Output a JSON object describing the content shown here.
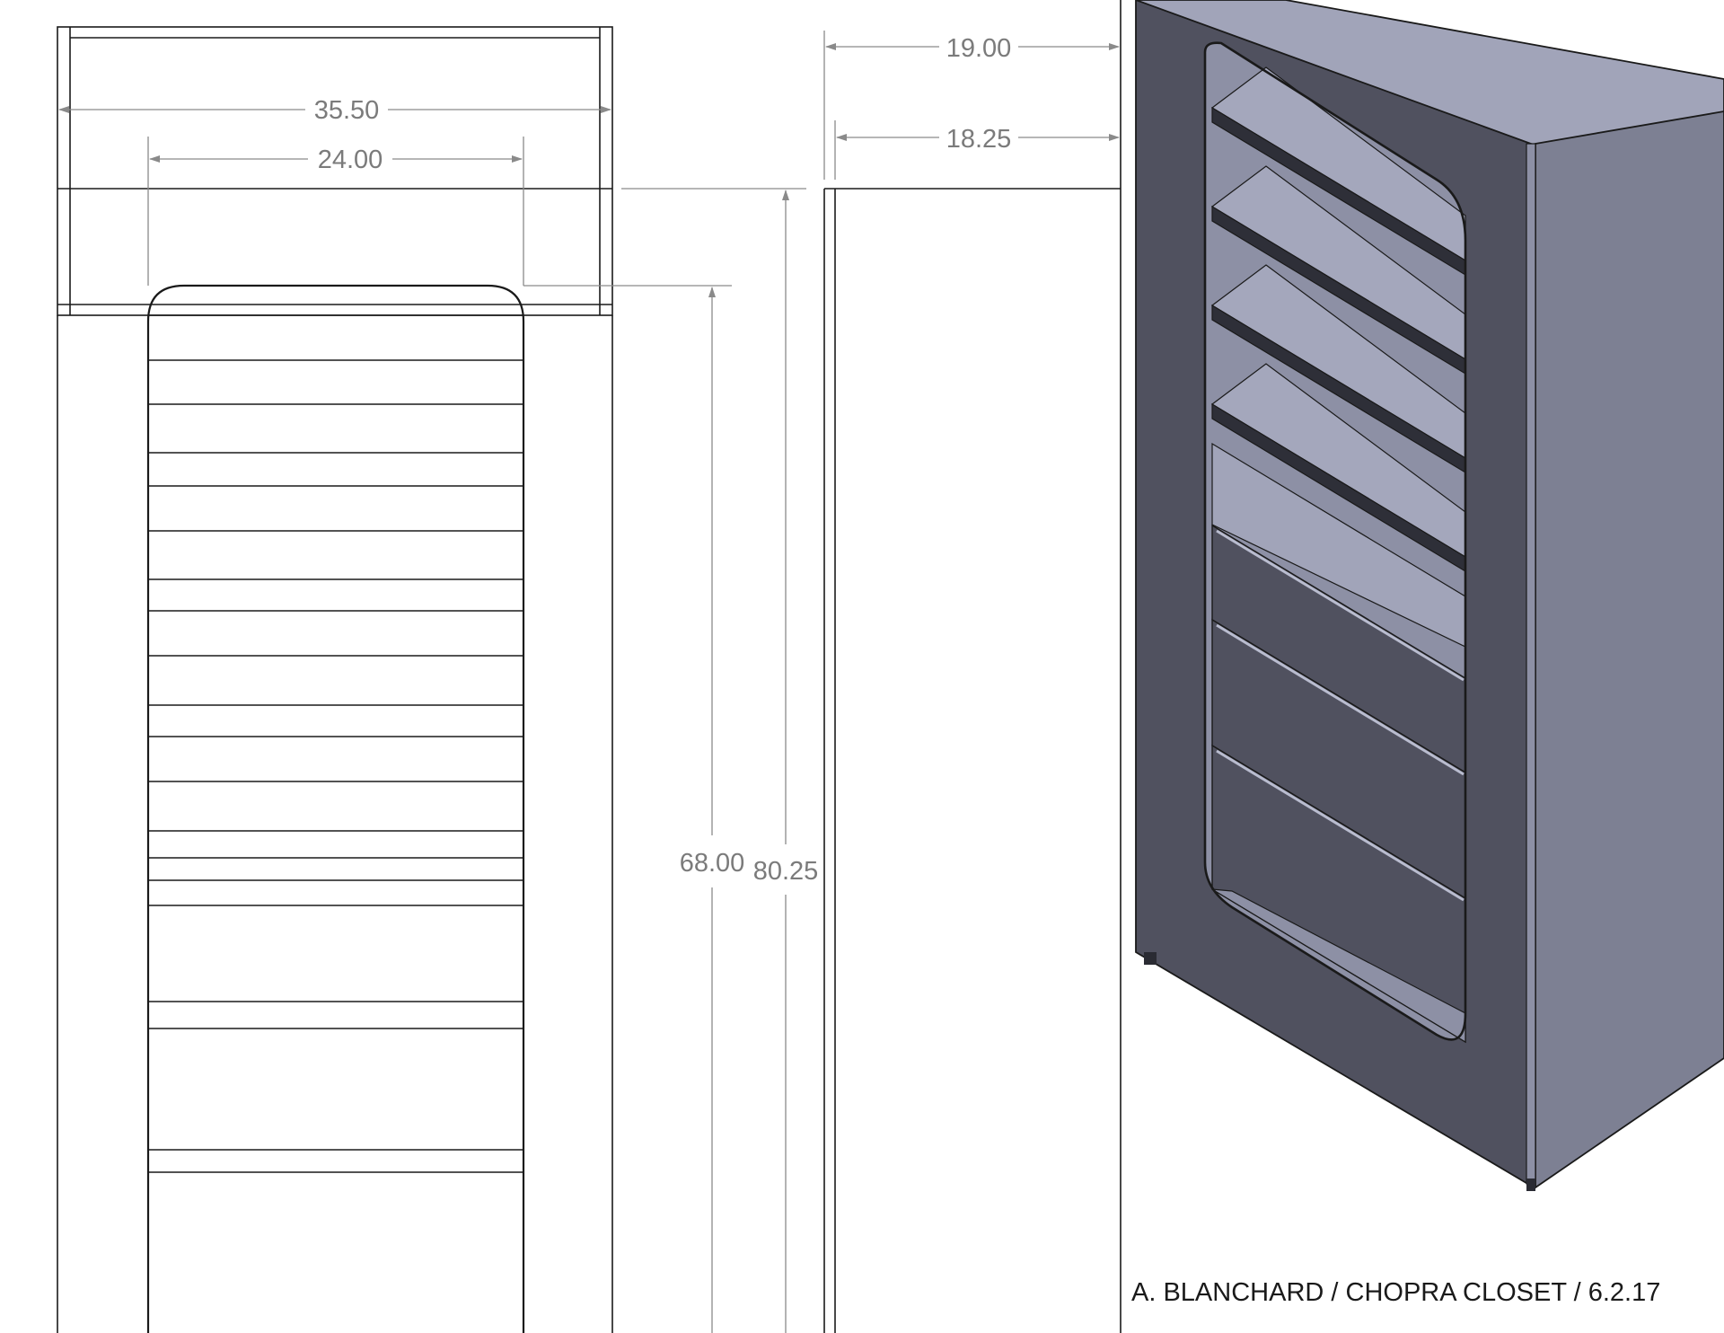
{
  "dimensions": {
    "overall_width": "35.50",
    "opening_width": "24.00",
    "overall_depth": "19.00",
    "interior_depth": "18.25",
    "opening_height": "68.00",
    "overall_height": "80.25"
  },
  "title_block": "A. BLANCHARD / CHOPRA CLOSET / 6.2.17",
  "colors": {
    "line": "#1a1a1a",
    "dimension": "#8a8a8a",
    "iso_front_face": "#50515f",
    "iso_side_face": "#7d8093",
    "iso_top_face": "#a1a4b9",
    "iso_shelf": "#8d90a5"
  }
}
